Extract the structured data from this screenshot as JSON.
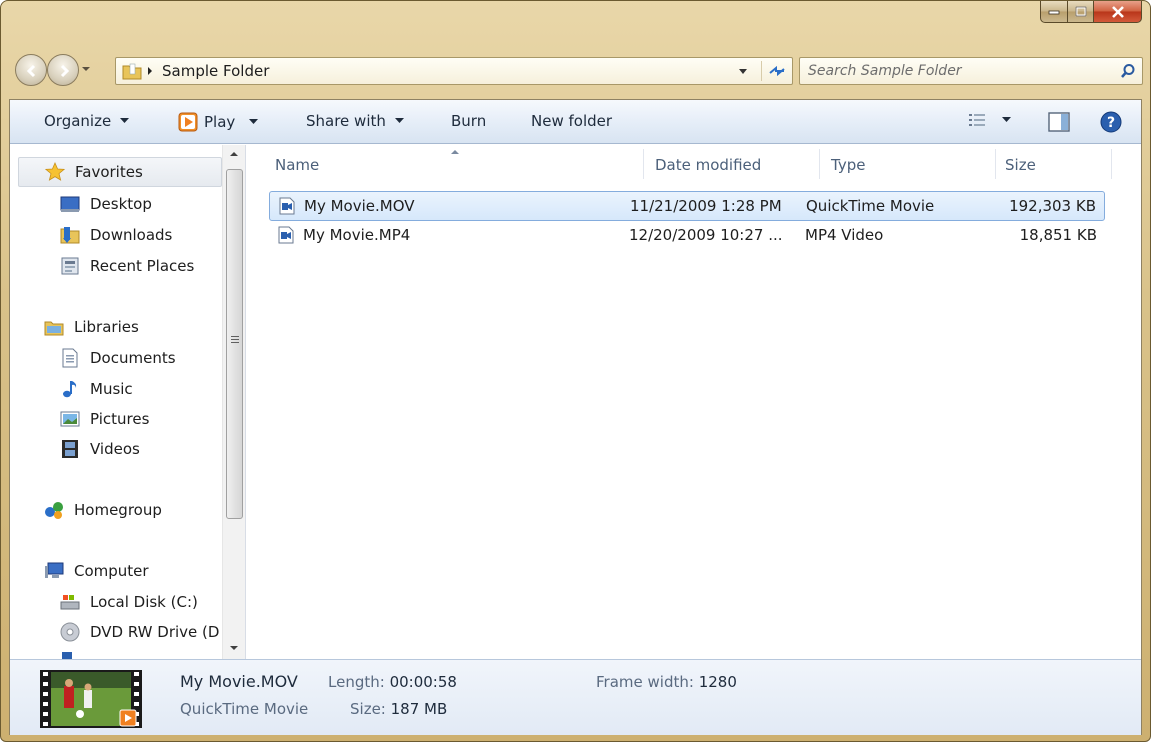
{
  "window": {
    "colors": {
      "frame": "#d9c28a",
      "accent": "#84acdd",
      "close": "#c94c2e"
    }
  },
  "address": {
    "crumb": "Sample Folder",
    "search_placeholder": "Search Sample Folder"
  },
  "toolbar": {
    "organize": "Organize",
    "play": "Play",
    "share_with": "Share with",
    "burn": "Burn",
    "new_folder": "New folder"
  },
  "nav": {
    "favorites": "Favorites",
    "desktop": "Desktop",
    "downloads": "Downloads",
    "recent_places": "Recent Places",
    "libraries": "Libraries",
    "documents": "Documents",
    "music": "Music",
    "pictures": "Pictures",
    "videos": "Videos",
    "homegroup": "Homegroup",
    "computer": "Computer",
    "local_disk": "Local Disk (C:)",
    "dvd_drive": "DVD RW Drive (D"
  },
  "columns": {
    "name": "Name",
    "date": "Date modified",
    "type": "Type",
    "size": "Size"
  },
  "files": [
    {
      "name": "My Movie.MOV",
      "date": "11/21/2009 1:28 PM",
      "type": "QuickTime Movie",
      "size": "192,303 KB"
    },
    {
      "name": "My Movie.MP4",
      "date": "12/20/2009 10:27 ...",
      "type": "MP4 Video",
      "size": "18,851 KB"
    }
  ],
  "details": {
    "name": "My Movie.MOV",
    "type": "QuickTime Movie",
    "length_label": "Length:",
    "length_value": "00:00:58",
    "size_label": "Size:",
    "size_value": "187 MB",
    "frame_width_label": "Frame width:",
    "frame_width_value": "1280"
  }
}
